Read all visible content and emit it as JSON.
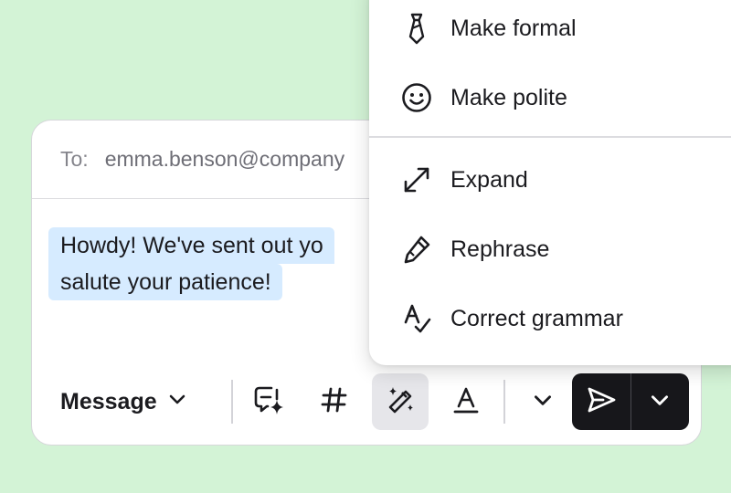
{
  "compose": {
    "to_label": "To:",
    "to_value": "emma.benson@company",
    "message_lines": [
      "Howdy! We've sent out yo",
      "salute your patience!"
    ]
  },
  "toolbar": {
    "mode_label": "Message",
    "icons": [
      "ai-chat-sparkle-icon",
      "hashtag-icon",
      "magic-wand-icon",
      "text-format-icon",
      "chevron-down-icon",
      "send-icon",
      "chevron-down-icon"
    ]
  },
  "menu": {
    "items": [
      {
        "label": "Make formal",
        "icon": "necktie-icon"
      },
      {
        "label": "Make polite",
        "icon": "smiley-icon"
      },
      {
        "label": "Expand",
        "icon": "expand-arrows-icon"
      },
      {
        "label": "Rephrase",
        "icon": "pencil-icon"
      },
      {
        "label": "Correct grammar",
        "icon": "grammar-check-icon"
      }
    ]
  },
  "colors": {
    "background": "#d3f3d6",
    "highlight": "#d6ebff",
    "send_button": "#17171b",
    "active_tool": "#e6e6ea"
  }
}
